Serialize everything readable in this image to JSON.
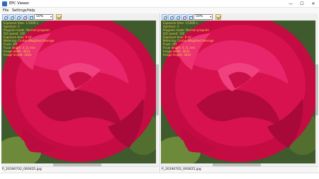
{
  "window": {
    "title": "EPC Viewer",
    "minimize_glyph": "—",
    "maximize_glyph": "☐",
    "close_glyph": "✕"
  },
  "menu": [
    "File",
    "Settings",
    "Help"
  ],
  "toolbar": {
    "icons": [
      "zoom-in-icon",
      "zoom-out-icon",
      "fit-window-icon",
      "magnifier-icon",
      "rotate-icon",
      "previous-icon",
      "next-icon"
    ],
    "zoom_value": "50%",
    "dropdown_glyph": "▾"
  },
  "panes": [
    {
      "info_lines": [
        "Exposure time: 1/1000 s",
        "Aperture: 2",
        "Program mode: Normal program",
        "ISO speed: 100",
        "Exposure bias: 0 eV",
        "Metering: Center-Weighted Average",
        "Flash: Off",
        "Focal length: 4.31 mm",
        "Image width: 4032",
        "Image height: 3024"
      ],
      "filename": "P_20190702_093625.jpg"
    },
    {
      "info_lines": [
        "Exposure time: 1/1000 s",
        "Aperture: 2",
        "Program mode: Normal program",
        "ISO speed: 100",
        "Exposure bias: 0 eV",
        "Metering: Center-Weighted Average",
        "Flash: Off",
        "Focal length: 4.31 mm",
        "Image width: 4032",
        "Image height: 3024"
      ],
      "filename": "P_20190702_093625.jpg"
    }
  ],
  "colors": {
    "overlay_text": "#f5d04a",
    "rose": "#d0104a",
    "foliage": "#3f5a2c"
  }
}
